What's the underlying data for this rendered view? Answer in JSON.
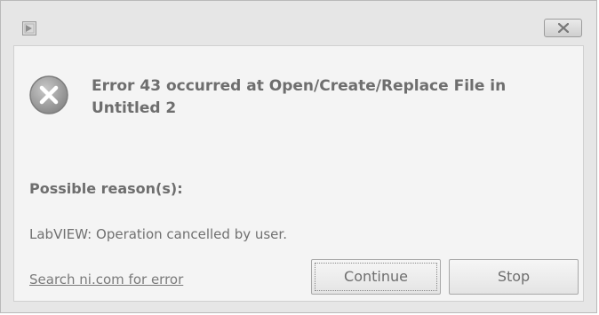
{
  "dialog": {
    "title": "",
    "error_heading": "Error 43 occurred at Open/Create/Replace File in Untitled 2",
    "reasons_heading": "Possible reason(s):",
    "reason_text": "LabVIEW:  Operation cancelled by user.",
    "search_link": "Search ni.com for error",
    "buttons": {
      "continue_label": "Continue",
      "stop_label": "Stop"
    },
    "icons": {
      "app": "labview-app-icon",
      "close": "close-icon",
      "error": "error-icon"
    }
  }
}
